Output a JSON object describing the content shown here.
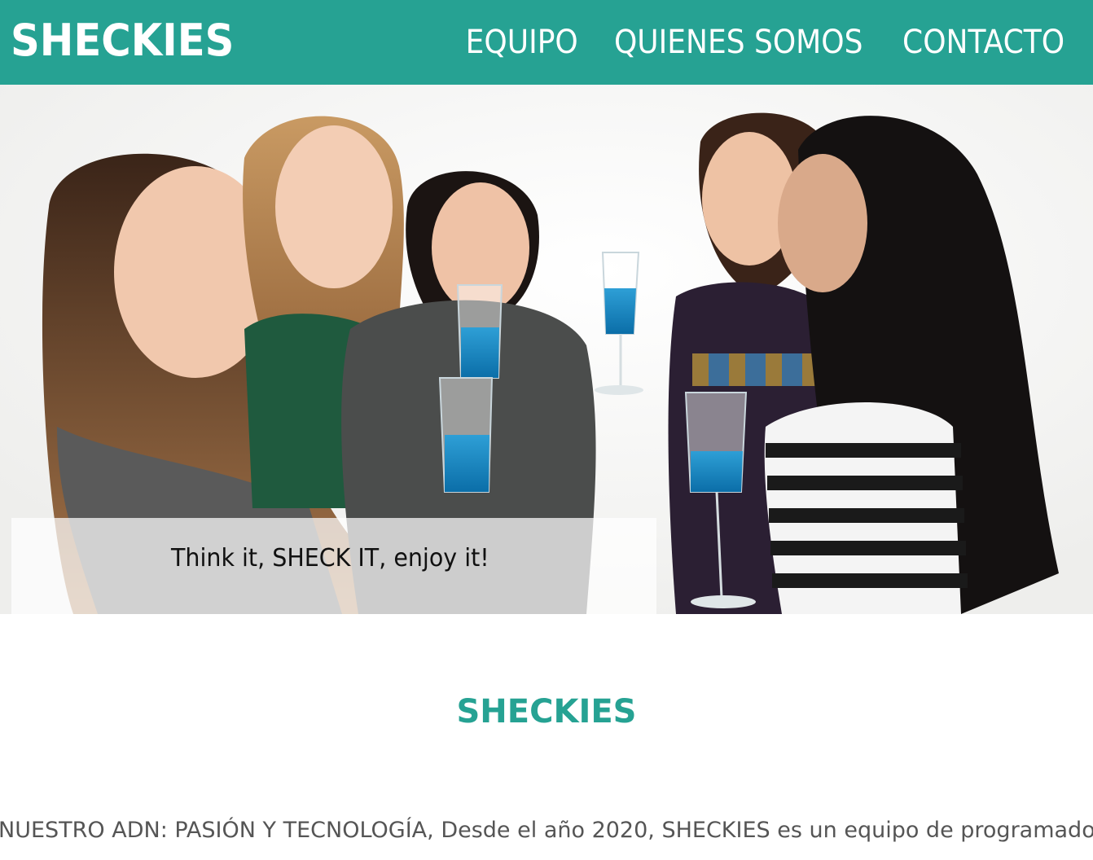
{
  "header": {
    "brand": "SHECKIES",
    "nav": [
      {
        "label": "EQUIPO"
      },
      {
        "label": "QUIENES SOMOS"
      },
      {
        "label": "CONTACTO"
      }
    ],
    "background_color": "#26a293"
  },
  "hero": {
    "image_alt": "Five women smiling and toasting with blue drinks in champagne glasses",
    "tagline": "Think it, SHECK IT, enjoy it!"
  },
  "section": {
    "title": "SHECKIES",
    "text": "NUESTRO ADN: PASIÓN Y TECNOLOGÍA, Desde el año 2020, SHECKIES es un equipo de programadoras"
  }
}
